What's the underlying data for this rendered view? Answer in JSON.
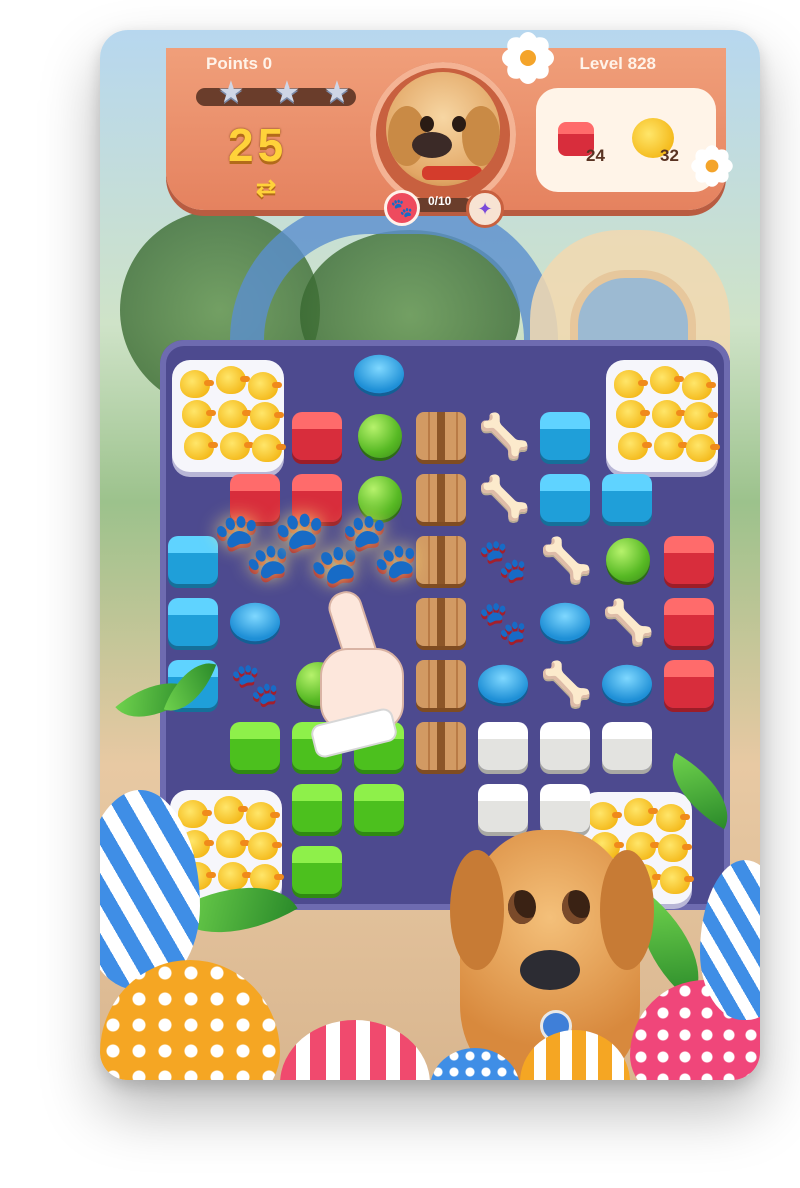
{
  "hud": {
    "points_label": "Points 0",
    "level_label": "Level 828",
    "moves_left": "25",
    "swap_symbol": "⇄",
    "paw_progress": "0/10",
    "stars_earned": 0,
    "stars_total": 3,
    "goals": [
      {
        "item": "red-box",
        "count": "24"
      },
      {
        "item": "rubber-duck",
        "count": "32"
      }
    ]
  },
  "colors": {
    "hud_orange": "#e5825f",
    "board_purple": "#4d4a8f",
    "moves_yellow": "#ffd23a"
  },
  "board": {
    "tiles": [
      {
        "c": 3,
        "r": 0,
        "t": "frisbee"
      },
      {
        "c": 2,
        "r": 1,
        "t": "box-red"
      },
      {
        "c": 3,
        "r": 1,
        "t": "ball"
      },
      {
        "c": 4,
        "r": 1,
        "t": "crate"
      },
      {
        "c": 5,
        "r": 1,
        "t": "bone"
      },
      {
        "c": 6,
        "r": 1,
        "t": "box-blue"
      },
      {
        "c": 1,
        "r": 2,
        "t": "box-red"
      },
      {
        "c": 2,
        "r": 2,
        "t": "box-red"
      },
      {
        "c": 3,
        "r": 2,
        "t": "ball"
      },
      {
        "c": 4,
        "r": 2,
        "t": "crate"
      },
      {
        "c": 5,
        "r": 2,
        "t": "bone"
      },
      {
        "c": 6,
        "r": 2,
        "t": "box-blue"
      },
      {
        "c": 7,
        "r": 2,
        "t": "box-blue"
      },
      {
        "c": 0,
        "r": 3,
        "t": "box-blue"
      },
      {
        "c": 4,
        "r": 3,
        "t": "crate"
      },
      {
        "c": 5,
        "r": 3,
        "t": "paw"
      },
      {
        "c": 6,
        "r": 3,
        "t": "bone"
      },
      {
        "c": 7,
        "r": 3,
        "t": "ball"
      },
      {
        "c": 8,
        "r": 3,
        "t": "box-red"
      },
      {
        "c": 0,
        "r": 4,
        "t": "box-blue"
      },
      {
        "c": 1,
        "r": 4,
        "t": "frisbee"
      },
      {
        "c": 4,
        "r": 4,
        "t": "crate"
      },
      {
        "c": 5,
        "r": 4,
        "t": "paw"
      },
      {
        "c": 6,
        "r": 4,
        "t": "frisbee"
      },
      {
        "c": 7,
        "r": 4,
        "t": "bone"
      },
      {
        "c": 8,
        "r": 4,
        "t": "box-red"
      },
      {
        "c": 0,
        "r": 5,
        "t": "box-blue"
      },
      {
        "c": 1,
        "r": 5,
        "t": "paw"
      },
      {
        "c": 2,
        "r": 5,
        "t": "ball"
      },
      {
        "c": 4,
        "r": 5,
        "t": "crate"
      },
      {
        "c": 5,
        "r": 5,
        "t": "frisbee"
      },
      {
        "c": 6,
        "r": 5,
        "t": "bone"
      },
      {
        "c": 7,
        "r": 5,
        "t": "frisbee"
      },
      {
        "c": 8,
        "r": 5,
        "t": "box-red"
      },
      {
        "c": 1,
        "r": 6,
        "t": "box-green"
      },
      {
        "c": 2,
        "r": 6,
        "t": "box-green"
      },
      {
        "c": 3,
        "r": 6,
        "t": "box-green"
      },
      {
        "c": 4,
        "r": 6,
        "t": "crate"
      },
      {
        "c": 5,
        "r": 6,
        "t": "box-white"
      },
      {
        "c": 6,
        "r": 6,
        "t": "box-white"
      },
      {
        "c": 7,
        "r": 6,
        "t": "box-white"
      },
      {
        "c": 2,
        "r": 7,
        "t": "box-green"
      },
      {
        "c": 3,
        "r": 7,
        "t": "box-green"
      },
      {
        "c": 5,
        "r": 7,
        "t": "box-white"
      },
      {
        "c": 6,
        "r": 7,
        "t": "box-white"
      },
      {
        "c": 2,
        "r": 8,
        "t": "box-green"
      }
    ],
    "duck_boxes": [
      "top-left",
      "top-right",
      "bottom-left",
      "bottom-right"
    ],
    "highlighted": "paw-match-row"
  }
}
